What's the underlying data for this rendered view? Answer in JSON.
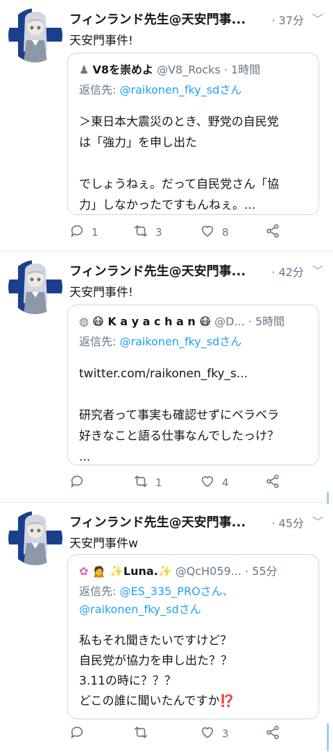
{
  "tweets": [
    {
      "name": "フィンランド先生@天安門事...",
      "time": "· 37分",
      "text": "天安門事件!",
      "quote": {
        "name": "V8を崇めよ",
        "handle": "@V8_Rocks",
        "time": "· 1時間",
        "reply_label": "返信先:",
        "reply_handles": "@raikonen_fky_sdさん",
        "reply_handles2": "",
        "body": [
          "＞東日本大震災のとき、野党の自民党",
          "は「強力」を申し出た",
          "",
          "でしょうねぇ。だって自民党さん「協",
          "力」しなかったですもんねぇ。..."
        ]
      },
      "replies": "1",
      "retweets": "3",
      "likes": "8"
    },
    {
      "name": "フィンランド先生@天安門事...",
      "time": "· 42分",
      "text": "天安門事件!",
      "quote": {
        "name": "😷 K a y a c h a n 😷",
        "handle": "@D...",
        "time": "· 5時間",
        "reply_label": "返信先:",
        "reply_handles": "@raikonen_fky_sdさん",
        "reply_handles2": "",
        "body": [
          "twitter.com/raikonen_fky_s...",
          "",
          "研究者って事実も確認せずにベラベラ",
          "好きなこと語る仕事なんでしたっけ？",
          "..."
        ]
      },
      "replies": "",
      "retweets": "1",
      "likes": "4"
    },
    {
      "name": "フィンランド先生@天安門事...",
      "time": "· 45分",
      "text": "天安門事件w",
      "quote": {
        "name": "🙍 ✨Luna.✨",
        "handle": "@QcH059...",
        "time": "· 55分",
        "reply_label": "返信先:",
        "reply_handles": "@ES_335_PROさん、",
        "reply_handles2": "@raikonen_fky_sdさん",
        "body": [
          "私もそれ聞きたいですけど？",
          "自民党が協力を申し出た？？",
          "3.11の時に？？？",
          "どこの誰に聞いたんですか⁉️"
        ]
      },
      "replies": "",
      "retweets": "",
      "likes": "3"
    }
  ],
  "colors": {
    "accent": "#1da1f2",
    "muted": "#657786",
    "border": "#ccd6dd",
    "flag_blue": "#1a3f8c"
  },
  "icons": [
    "reply-icon",
    "retweet-icon",
    "like-icon",
    "share-icon",
    "chevron-down-icon"
  ]
}
